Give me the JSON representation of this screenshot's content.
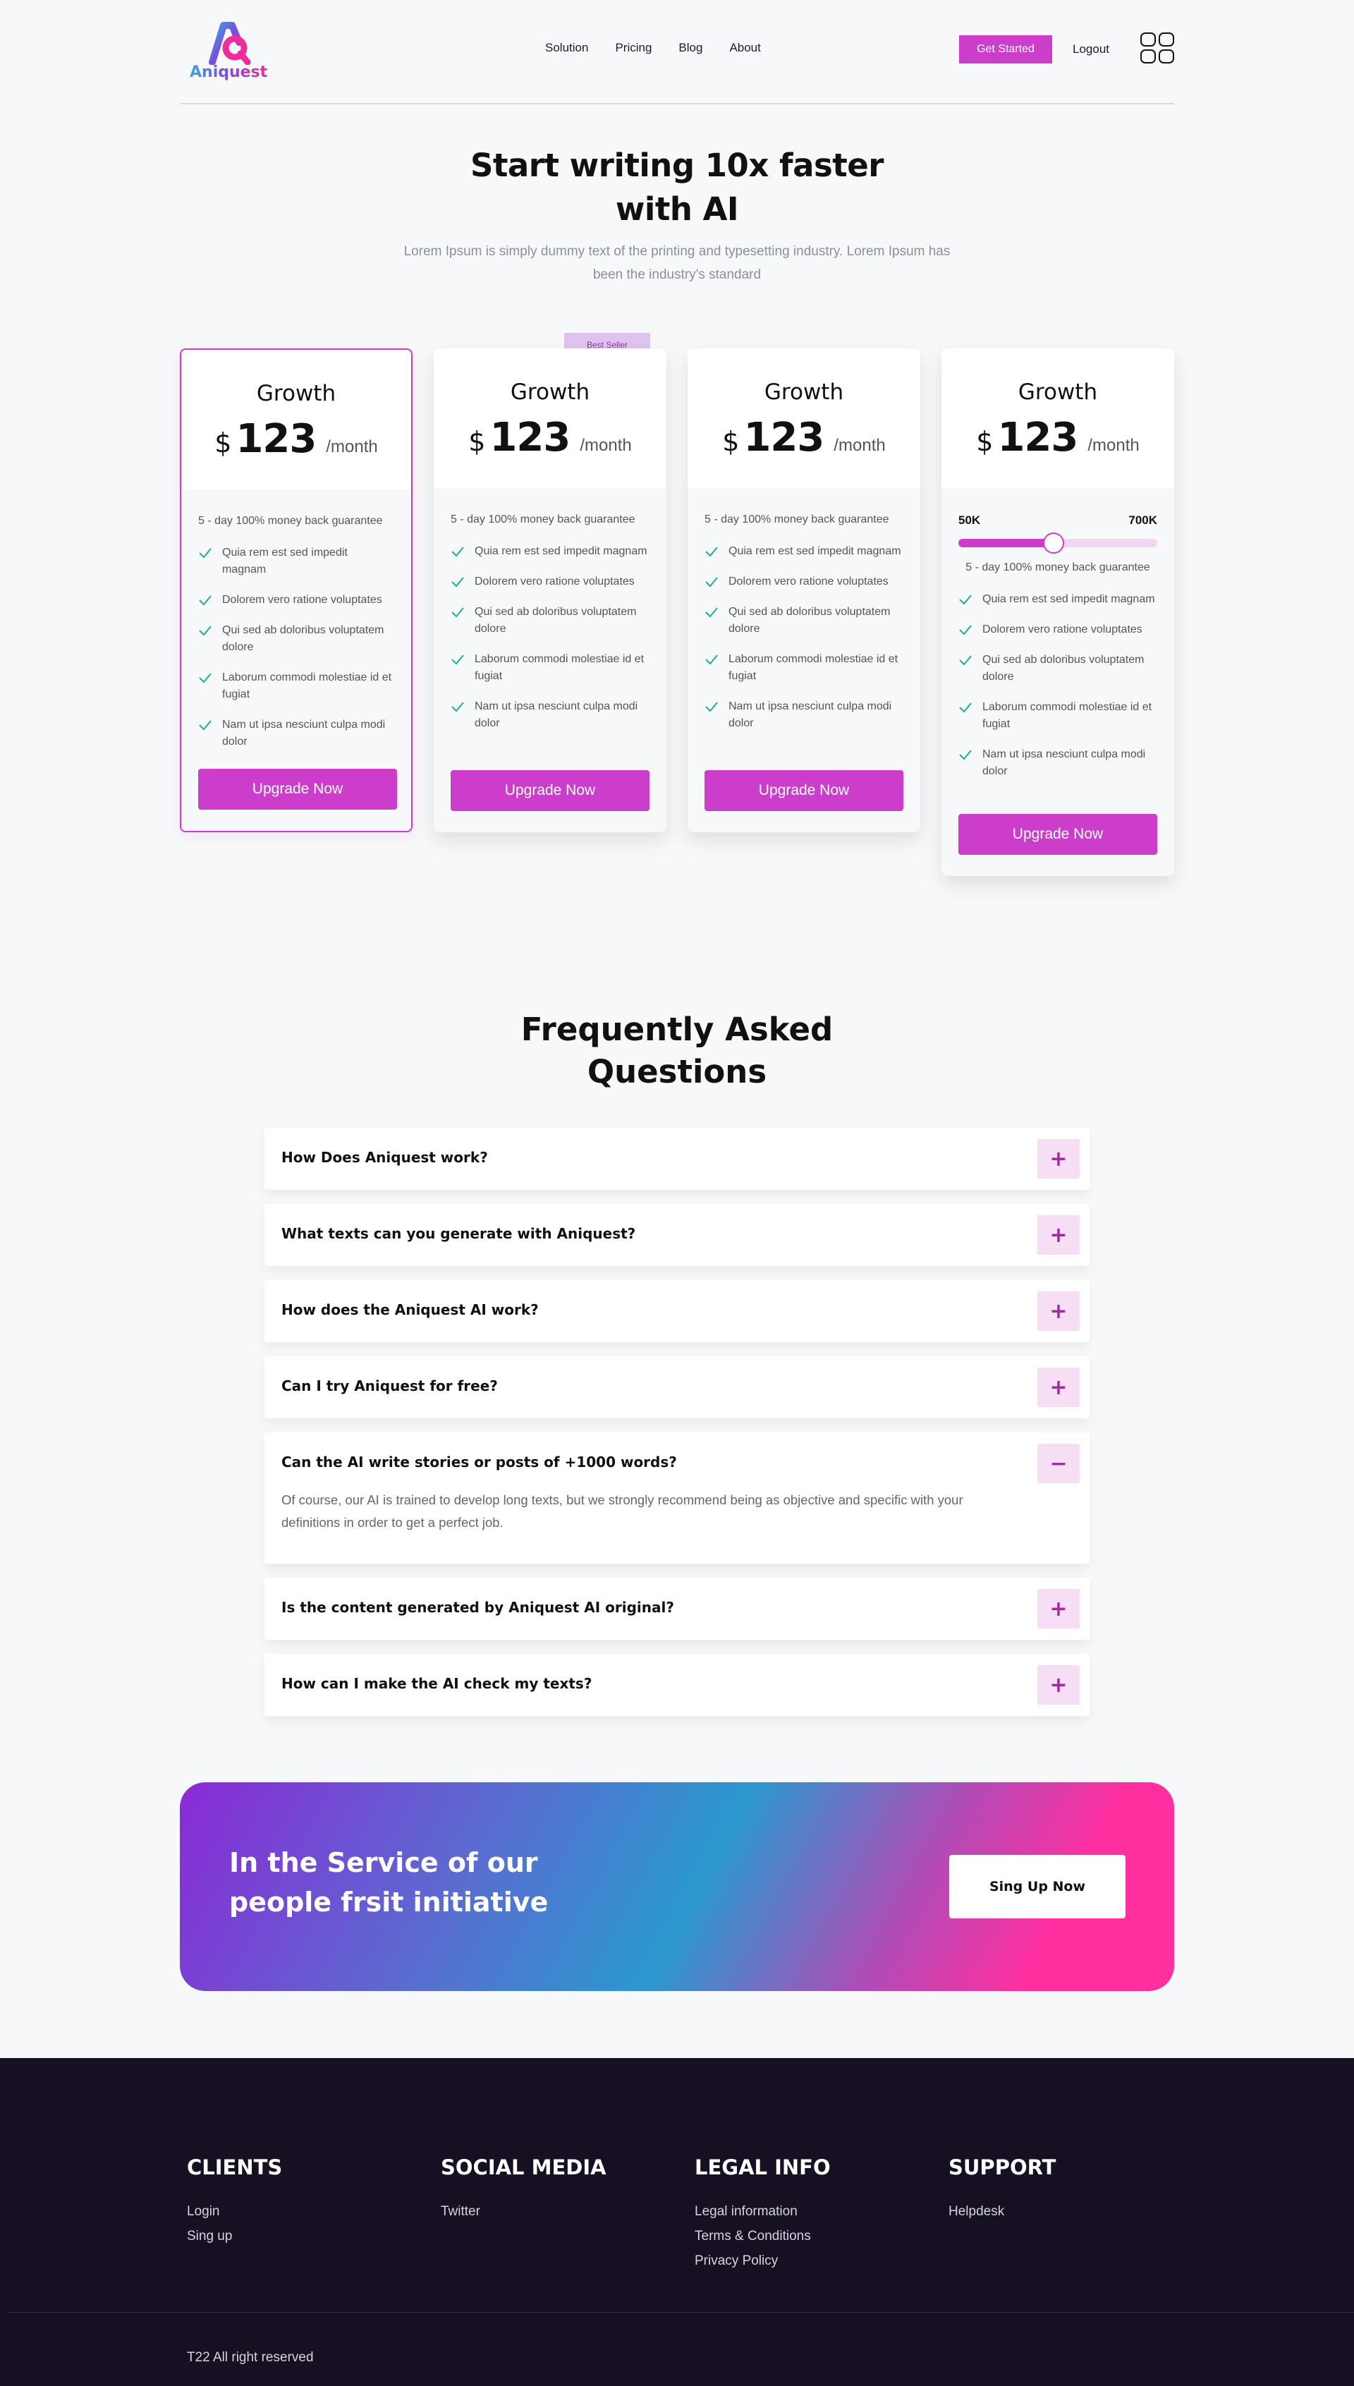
{
  "header": {
    "logo_text": "Aniquest",
    "nav": [
      "Solution",
      "Pricing",
      "Blog",
      "About"
    ],
    "get_started": "Get Started",
    "logout": "Logout"
  },
  "hero": {
    "title_line1": "Start writing 10x faster",
    "title_line2": "with AI",
    "subtitle": "Lorem Ipsum is simply dummy text of the printing and typesetting industry. Lorem Ipsum has been the industry's standard"
  },
  "pricing": {
    "best_seller": "Best Seller",
    "cards": [
      {
        "name": "Growth",
        "currency": "$",
        "price": "123",
        "period": "/month",
        "guarantee": "5 - day 100% money back guarantee",
        "features": [
          "Quia rem est sed impedit magnam",
          "Dolorem vero ratione voluptates",
          "Qui sed ab doloribus voluptatem dolore",
          "Laborum commodi molestiae id et fugiat",
          "Nam ut ipsa nesciunt culpa modi dolor"
        ],
        "button": "Upgrade Now"
      },
      {
        "name": "Growth",
        "currency": "$",
        "price": "123",
        "period": "/month",
        "guarantee": "5 - day 100% money back guarantee",
        "features": [
          "Quia rem est sed impedit magnam",
          "Dolorem vero ratione voluptates",
          "Qui sed ab doloribus voluptatem dolore",
          "Laborum commodi molestiae id et fugiat",
          "Nam ut ipsa nesciunt culpa modi dolor"
        ],
        "button": "Upgrade Now"
      },
      {
        "name": "Growth",
        "currency": "$",
        "price": "123",
        "period": "/month",
        "guarantee": "5 - day 100% money back guarantee",
        "features": [
          "Quia rem est sed impedit magnam",
          "Dolorem vero ratione voluptates",
          "Qui sed ab doloribus voluptatem dolore",
          "Laborum commodi molestiae id et fugiat",
          "Nam ut ipsa nesciunt culpa modi dolor"
        ],
        "button": "Upgrade Now"
      },
      {
        "name": "Growth",
        "currency": "$",
        "price": "123",
        "period": "/month",
        "range_min": "50K",
        "range_max": "700K",
        "slider_fraction": 0.48,
        "guarantee": "5 - day 100% money back guarantee",
        "features": [
          "Quia rem est sed impedit magnam",
          "Dolorem vero ratione voluptates",
          "Qui sed ab doloribus voluptatem dolore",
          "Laborum commodi molestiae id et fugiat",
          "Nam ut ipsa nesciunt culpa modi dolor"
        ],
        "button": "Upgrade Now"
      }
    ]
  },
  "faq": {
    "title_line1": "Frequently Asked",
    "title_line2": "Questions",
    "items": [
      {
        "q": "How Does Aniquest work?",
        "toggle": "+"
      },
      {
        "q": "What texts can you generate with Aniquest?",
        "toggle": "+"
      },
      {
        "q": "How does the Aniquest AI work?",
        "toggle": "+"
      },
      {
        "q": "Can I try Aniquest for free?",
        "toggle": "+"
      },
      {
        "q": "Can the AI write stories or posts of +1000 words?",
        "toggle": "−",
        "a": "Of course, our AI is trained to develop long texts, but we strongly recommend being as objective and specific with your definitions in order to get a perfect job."
      },
      {
        "q": "Is the content generated by Aniquest AI original?",
        "toggle": "+"
      },
      {
        "q": "How can I make the AI check my texts?",
        "toggle": "+"
      }
    ]
  },
  "cta": {
    "line1": "In the Service of our",
    "line2": "people frsit initiative",
    "button": "Sing Up Now"
  },
  "footer": {
    "columns": [
      {
        "title": "CLIENTS",
        "links": [
          "Login",
          "Sing up"
        ]
      },
      {
        "title": "SOCIAL MEDIA",
        "links": [
          "Twitter"
        ]
      },
      {
        "title": "LEGAL INFO",
        "links": [
          "Legal information",
          "Terms & Conditions",
          "Privacy Policy"
        ]
      },
      {
        "title": "SUPPORT",
        "links": [
          "Helpdesk"
        ]
      }
    ],
    "copyright": "T22 All right reserved"
  },
  "colors": {
    "accent": "#cc3dcc",
    "check": "#22b07d",
    "footer_bg": "#161022"
  }
}
